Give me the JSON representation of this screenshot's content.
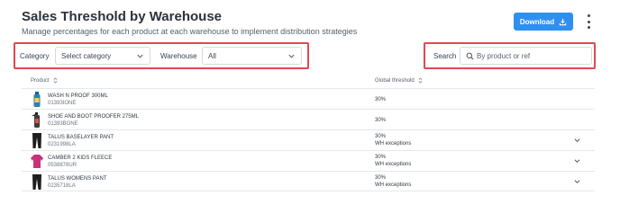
{
  "header": {
    "title": "Sales Threshold by Warehouse",
    "subtitle": "Manage percentages for each product at each warehouse to implement distribution strategies",
    "download_label": "Download"
  },
  "filters": {
    "category_label": "Category",
    "category_value": "Select category",
    "warehouse_label": "Warehouse",
    "warehouse_value": "All",
    "search_label": "Search",
    "search_placeholder": "By product or ref"
  },
  "table": {
    "columns": [
      "Product",
      "Global threshold"
    ],
    "rows": [
      {
        "name": "WASH N PROOF 300ML",
        "ref": "01393IONE",
        "threshold": "30%",
        "exceptions": "",
        "expandable": false,
        "thumb_color": "#2a7fb8"
      },
      {
        "name": "SHOE AND BOOT PROOFER 275ML",
        "ref": "01393BONE",
        "threshold": "30%",
        "exceptions": "",
        "expandable": false,
        "thumb_color": "#3d3d3d"
      },
      {
        "name": "TALUS BASELAYER PANT",
        "ref": "0231998LA",
        "threshold": "30%",
        "exceptions": "WH exceptions",
        "expandable": true,
        "thumb_color": "#1e1e1e"
      },
      {
        "name": "CAMBER 2 KIDS FLEECE",
        "ref": "0538878UR",
        "threshold": "30%",
        "exceptions": "WH exceptions",
        "expandable": true,
        "thumb_color": "#c8327a"
      },
      {
        "name": "TALUS WOMENS PANT",
        "ref": "0235718LA",
        "threshold": "30%",
        "exceptions": "WH exceptions",
        "expandable": true,
        "thumb_color": "#1e1e1e"
      }
    ]
  },
  "colors": {
    "accent": "#2e8ff0",
    "highlight_border": "#e04852"
  }
}
